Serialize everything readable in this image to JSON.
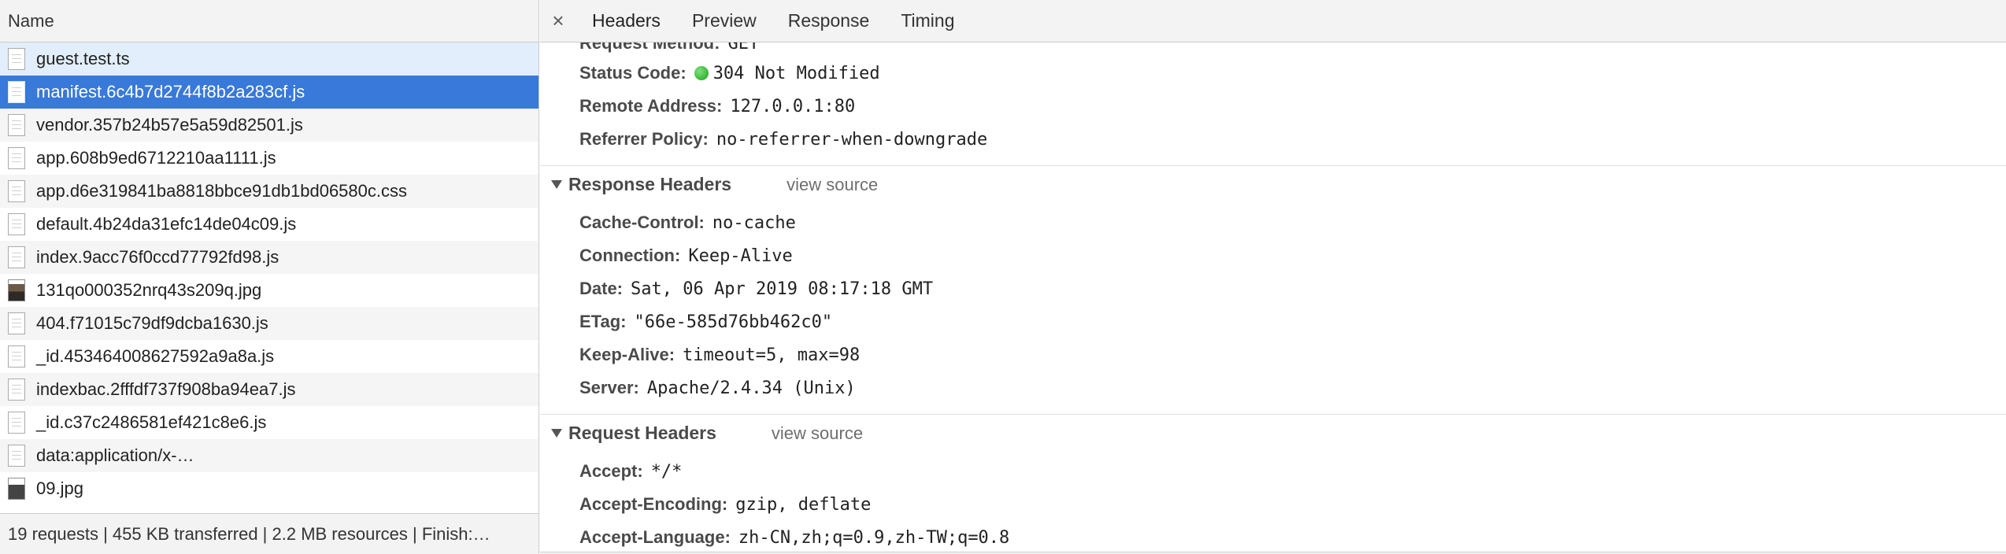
{
  "left": {
    "header_label": "Name",
    "requests": [
      {
        "name": "guest.test.ts",
        "icon": "file-icon"
      },
      {
        "name": "manifest.6c4b7d2744f8b2a283cf.js",
        "icon": "file-icon"
      },
      {
        "name": "vendor.357b24b57e5a59d82501.js",
        "icon": "file-icon"
      },
      {
        "name": "app.608b9ed6712210aa1111.js",
        "icon": "file-icon"
      },
      {
        "name": "app.d6e319841ba8818bbce91db1bd06580c.css",
        "icon": "file-icon"
      },
      {
        "name": "default.4b24da31efc14de04c09.js",
        "icon": "file-icon"
      },
      {
        "name": "index.9acc76f0ccd77792fd98.js",
        "icon": "file-icon"
      },
      {
        "name": "131qo000352nrq43s209q.jpg",
        "icon": "image-icon"
      },
      {
        "name": "404.f71015c79df9dcba1630.js",
        "icon": "file-icon"
      },
      {
        "name": "_id.453464008627592a9a8a.js",
        "icon": "file-icon"
      },
      {
        "name": "indexbac.2fffdf737f908ba94ea7.js",
        "icon": "file-icon"
      },
      {
        "name": "_id.c37c2486581ef421c8e6.js",
        "icon": "file-icon"
      },
      {
        "name": "data:application/x-…",
        "icon": "file-icon"
      },
      {
        "name": "09.jpg",
        "icon": "image-icon"
      }
    ],
    "selected_index": 1,
    "footer": "19 requests | 455 KB transferred | 2.2 MB resources | Finish:…"
  },
  "right": {
    "close_symbol": "×",
    "tabs": [
      "Headers",
      "Preview",
      "Response",
      "Timing"
    ],
    "active_tab": "Headers",
    "general": [
      {
        "key": "Request Method:",
        "value": "GET"
      },
      {
        "key": "Status Code:",
        "value": "304 Not Modified"
      },
      {
        "key": "Remote Address:",
        "value": "127.0.0.1:80"
      },
      {
        "key": "Referrer Policy:",
        "value": "no-referrer-when-downgrade"
      }
    ],
    "response_headers": {
      "title": "Response Headers",
      "view_source": "view source",
      "rows": [
        {
          "key": "Cache-Control:",
          "value": "no-cache"
        },
        {
          "key": "Connection:",
          "value": "Keep-Alive"
        },
        {
          "key": "Date:",
          "value": "Sat, 06 Apr 2019 08:17:18 GMT"
        },
        {
          "key": "ETag:",
          "value": "\"66e-585d76bb462c0\""
        },
        {
          "key": "Keep-Alive:",
          "value": "timeout=5, max=98"
        },
        {
          "key": "Server:",
          "value": "Apache/2.4.34 (Unix)"
        }
      ]
    },
    "request_headers": {
      "title": "Request Headers",
      "view_source": "view source",
      "rows": [
        {
          "key": "Accept:",
          "value": "*/*"
        },
        {
          "key": "Accept-Encoding:",
          "value": "gzip, deflate"
        },
        {
          "key": "Accept-Language:",
          "value": "zh-CN,zh;q=0.9,zh-TW;q=0.8"
        }
      ]
    },
    "status_color": "#17a317"
  }
}
